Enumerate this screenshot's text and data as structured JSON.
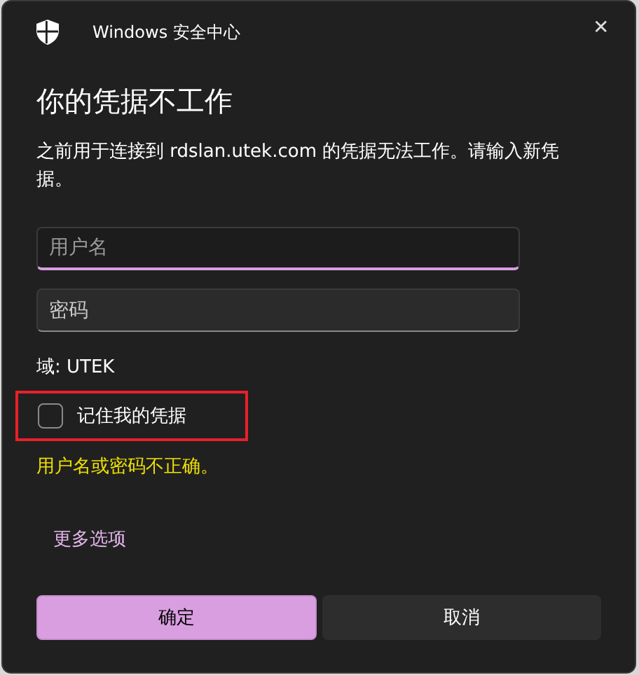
{
  "window": {
    "title": "Windows 安全中心",
    "close": "✕"
  },
  "heading": "你的凭据不工作",
  "message": "之前用于连接到 rdslan.utek.com 的凭据无法工作。请输入新凭据。",
  "fields": [
    {
      "placeholder": "用户名",
      "focused": true
    },
    {
      "placeholder": "密码",
      "focused": false
    }
  ],
  "domain": "域: UTEK",
  "remember": {
    "label": "记住我的凭据",
    "checked": false,
    "highlighted": true
  },
  "error": "用户名或密码不正确。",
  "more_options": "更多选项",
  "buttons": [
    {
      "label": "确定",
      "primary": true
    },
    {
      "label": "取消",
      "primary": false
    }
  ]
}
